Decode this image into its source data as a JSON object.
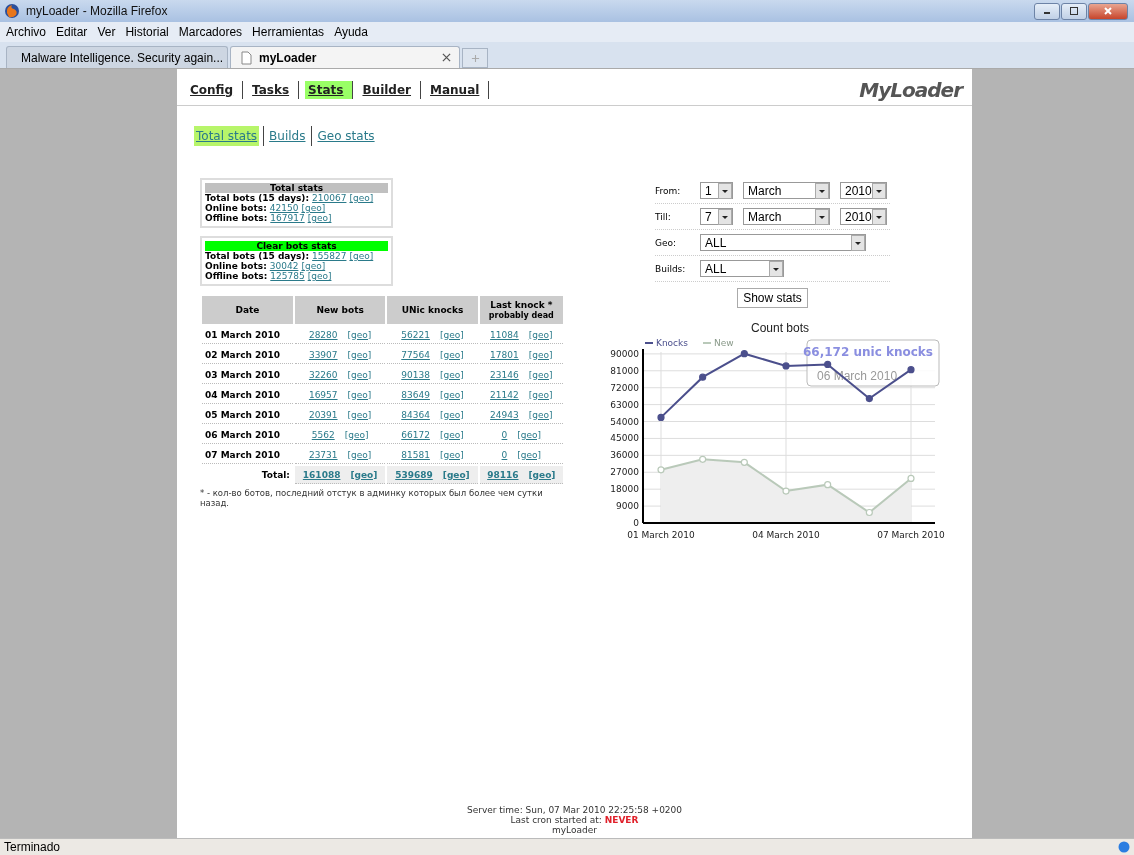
{
  "window": {
    "title": "myLoader - Mozilla Firefox"
  },
  "menu": [
    "Archivo",
    "Editar",
    "Ver",
    "Historial",
    "Marcadores",
    "Herramientas",
    "Ayuda"
  ],
  "tabs": [
    {
      "label": "Malware Intelligence. Security again...",
      "selected": false
    },
    {
      "label": "myLoader",
      "selected": true
    }
  ],
  "nav": [
    {
      "label": "Config",
      "selected": false
    },
    {
      "label": "Tasks",
      "selected": false
    },
    {
      "label": "Stats",
      "selected": true
    },
    {
      "label": "Builder",
      "selected": false
    },
    {
      "label": "Manual",
      "selected": false
    }
  ],
  "logo": "MyLoader",
  "subnav": [
    {
      "label": "Total stats",
      "selected": true
    },
    {
      "label": "Builds",
      "selected": false
    },
    {
      "label": "Geo stats",
      "selected": false
    }
  ],
  "summary_boxes": [
    {
      "title": "Total stats",
      "color": "#c0c0c0",
      "rows": [
        {
          "label": "Total bots (15 days):",
          "value": "210067",
          "link": "[geo]"
        },
        {
          "label": "Online bots:",
          "value": "42150",
          "link": "[geo]"
        },
        {
          "label": "Offline bots:",
          "value": "167917",
          "link": "[geo]"
        }
      ]
    },
    {
      "title": "Clear bots stats",
      "color": "#00ff00",
      "rows": [
        {
          "label": "Total bots (15 days):",
          "value": "155827",
          "link": "[geo]"
        },
        {
          "label": "Online bots:",
          "value": "30042",
          "link": "[geo]"
        },
        {
          "label": "Offline bots:",
          "value": "125785",
          "link": "[geo]"
        }
      ]
    }
  ],
  "table": {
    "columns": [
      {
        "label": "Date"
      },
      {
        "label": "New bots"
      },
      {
        "label": "UNic knocks"
      },
      {
        "label": "Last knock *",
        "sub": "probably dead"
      }
    ],
    "rows": [
      {
        "cells": [
          {
            "value": "01 March 2010"
          },
          {
            "value": "28280",
            "link": "[geo]"
          },
          {
            "value": "56221",
            "link": "[geo]"
          },
          {
            "value": "11084",
            "link": "[geo]"
          }
        ]
      },
      {
        "cells": [
          {
            "value": "02 March 2010"
          },
          {
            "value": "33907",
            "link": "[geo]"
          },
          {
            "value": "77564",
            "link": "[geo]"
          },
          {
            "value": "17801",
            "link": "[geo]"
          }
        ]
      },
      {
        "cells": [
          {
            "value": "03 March 2010"
          },
          {
            "value": "32260",
            "link": "[geo]"
          },
          {
            "value": "90138",
            "link": "[geo]"
          },
          {
            "value": "23146",
            "link": "[geo]"
          }
        ]
      },
      {
        "cells": [
          {
            "value": "04 March 2010"
          },
          {
            "value": "16957",
            "link": "[geo]"
          },
          {
            "value": "83649",
            "link": "[geo]"
          },
          {
            "value": "21142",
            "link": "[geo]"
          }
        ]
      },
      {
        "cells": [
          {
            "value": "05 March 2010"
          },
          {
            "value": "20391",
            "link": "[geo]"
          },
          {
            "value": "84364",
            "link": "[geo]"
          },
          {
            "value": "24943",
            "link": "[geo]"
          }
        ]
      },
      {
        "cells": [
          {
            "value": "06 March 2010"
          },
          {
            "value": "5562",
            "link": "[geo]"
          },
          {
            "value": "66172",
            "link": "[geo]"
          },
          {
            "value": "0",
            "link": "[geo]"
          }
        ]
      },
      {
        "cells": [
          {
            "value": "07 March 2010"
          },
          {
            "value": "23731",
            "link": "[geo]"
          },
          {
            "value": "81581",
            "link": "[geo]"
          },
          {
            "value": "0",
            "link": "[geo]"
          }
        ]
      },
      {
        "kind": "total",
        "cells": [
          {
            "value": "Total:"
          },
          {
            "value": "161088",
            "link": "[geo]"
          },
          {
            "value": "539689",
            "link": "[geo]"
          },
          {
            "value": "98116",
            "link": "[geo]"
          }
        ]
      }
    ]
  },
  "footnote": "* - кол-во ботов, последний отстук в админку которых был более чем сутки назад.",
  "filters": [
    {
      "label": "From:",
      "selects": [
        {
          "value": "1",
          "kind": "day"
        },
        {
          "value": "March",
          "kind": "month"
        },
        {
          "value": "2010",
          "kind": "year"
        }
      ]
    },
    {
      "label": "Till:",
      "selects": [
        {
          "value": "7",
          "kind": "day"
        },
        {
          "value": "March",
          "kind": "month"
        },
        {
          "value": "2010",
          "kind": "year"
        }
      ]
    },
    {
      "label": "Geo:",
      "selects": [
        {
          "value": "ALL",
          "kind": "wide"
        }
      ]
    },
    {
      "label": "Builds:",
      "selects": [
        {
          "value": "ALL",
          "kind": "medium"
        }
      ]
    }
  ],
  "show_button": "Show stats",
  "chart": {
    "chart_data": {
      "type": "line",
      "title": "Count bots",
      "grid": true,
      "categories": [
        "01 March 2010",
        null,
        null,
        "04 March 2010",
        null,
        null,
        "07 March 2010"
      ],
      "series": [
        {
          "name": "Knocks",
          "color": "#4b4f8c",
          "marker": "circle",
          "values": [
            56200,
            77600,
            90100,
            83600,
            84400,
            66200,
            81600
          ]
        },
        {
          "name": "New",
          "color": "#b9c9b9",
          "marker": "circle",
          "values": [
            28300,
            33900,
            32300,
            17000,
            20400,
            5600,
            23700
          ]
        }
      ],
      "ylim": [
        0,
        91000
      ],
      "yticks": [
        0,
        9000,
        18000,
        27000,
        36000,
        45000,
        54000,
        63000,
        72000,
        81000,
        90000
      ]
    },
    "tooltip": {
      "title": "66,172 unic knocks",
      "subtitle": "06 March 2010"
    }
  },
  "footer": {
    "server_time": "Server time: Sun, 07 Mar 2010 22:25:58 +0200",
    "cron_label": "Last cron started at:",
    "cron_value": "NEVER",
    "name": "myLoader"
  },
  "status_bar": "Terminado"
}
